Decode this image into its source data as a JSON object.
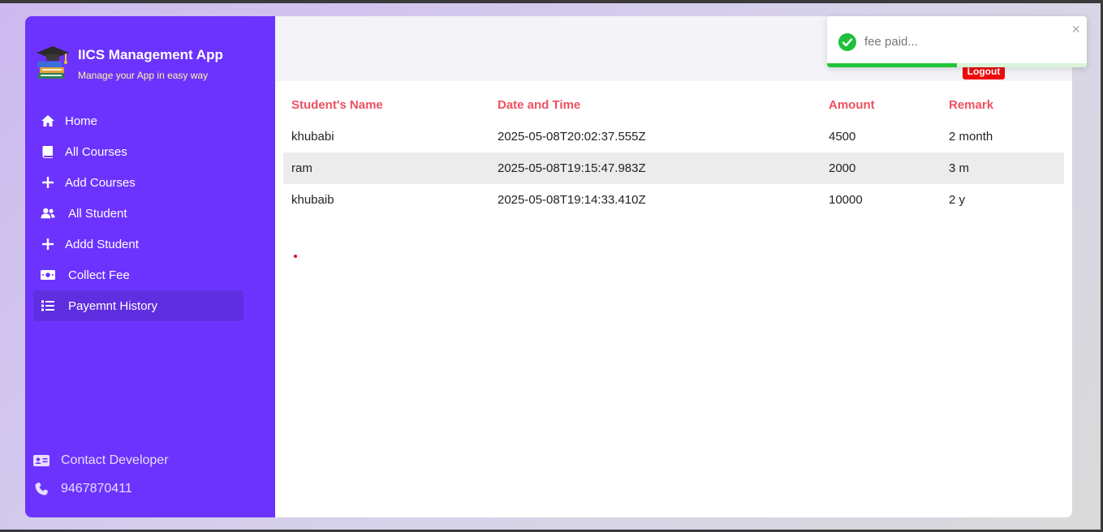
{
  "brand": {
    "title": "IICS Management App",
    "subtitle": "Manage your App in easy way"
  },
  "nav": [
    {
      "label": "Home",
      "icon": "home-icon"
    },
    {
      "label": "All Courses",
      "icon": "book-icon"
    },
    {
      "label": "Add Courses",
      "icon": "plus-icon"
    },
    {
      "label": "All Student",
      "icon": "users-icon"
    },
    {
      "label": "Addd Student",
      "icon": "plus-icon"
    },
    {
      "label": "Collect Fee",
      "icon": "money-icon"
    },
    {
      "label": "Payemnt History",
      "icon": "list-icon",
      "active": true
    }
  ],
  "contact": {
    "label": "Contact Developer",
    "phone": "9467870411"
  },
  "header": {
    "logout_label": "Logout"
  },
  "table": {
    "headers": [
      "Student's Name",
      "Date and Time",
      "Amount",
      "Remark"
    ],
    "rows": [
      [
        "khubabi",
        "2025-05-08T20:02:37.555Z",
        "4500",
        "2 month"
      ],
      [
        "ram",
        "2025-05-08T19:15:47.983Z",
        "2000",
        "3 m"
      ],
      [
        "khubaib",
        "2025-05-08T19:14:33.410Z",
        "10000",
        "2 y"
      ]
    ]
  },
  "toast": {
    "message": "fee paid...",
    "close": "×",
    "progress": 0.5
  },
  "colors": {
    "sidebar": "#6c33ff",
    "accent_header": "#ec5161",
    "logout": "#ee0b0b",
    "success": "#22c43a",
    "subtitle": "#fff7a3"
  }
}
